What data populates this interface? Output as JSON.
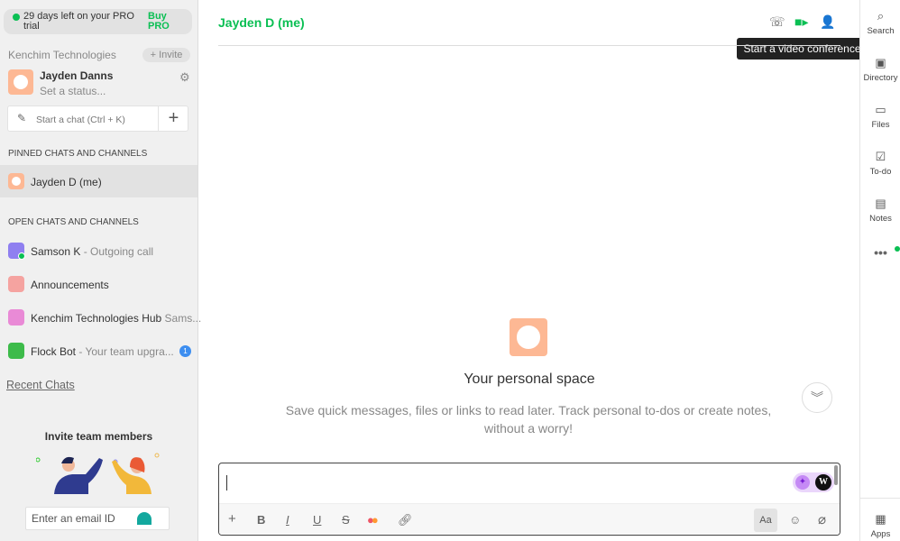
{
  "sidebar": {
    "trial_text": "29 days left on your PRO trial",
    "buy_label": "Buy PRO",
    "team_name": "Kenchim Technologies",
    "invite_label": "+ Invite",
    "user_name": "Jayden Danns",
    "user_status": "Set a status...",
    "start_chat": "Start a chat (Ctrl + K)",
    "pinned_header": "PINNED CHATS AND CHANNELS",
    "pinned": [
      {
        "name": "Jayden D (me)"
      }
    ],
    "open_header": "OPEN CHATS AND CHANNELS",
    "open": [
      {
        "name": "Samson K",
        "sub": " - Outgoing call",
        "color": "#8f7ff0"
      },
      {
        "name": "Announcements",
        "sub": "",
        "color": "#f5a3a0"
      },
      {
        "name": "Kenchim Technologies Hub",
        "sub": " Sams...",
        "color": "#e98ad6"
      },
      {
        "name": "Flock Bot",
        "sub": " - Your team upgra...",
        "color": "#3dbb4a",
        "badge": "1"
      }
    ],
    "recent_chats": "Recent Chats",
    "invite_heading": "Invite team members",
    "email_placeholder": "Enter an email ID"
  },
  "main": {
    "title": "Jayden D (me)",
    "tooltip": "Start a video conference",
    "personal_heading": "Your personal space",
    "personal_desc": "Save quick messages, files or links to read later. Track personal to-dos or create notes, without a worry!",
    "aa_label": "Aa",
    "accent": "#0abf53"
  },
  "rail": {
    "items": [
      "Search",
      "Directory",
      "Files",
      "To-do",
      "Notes"
    ],
    "apps": "Apps"
  }
}
